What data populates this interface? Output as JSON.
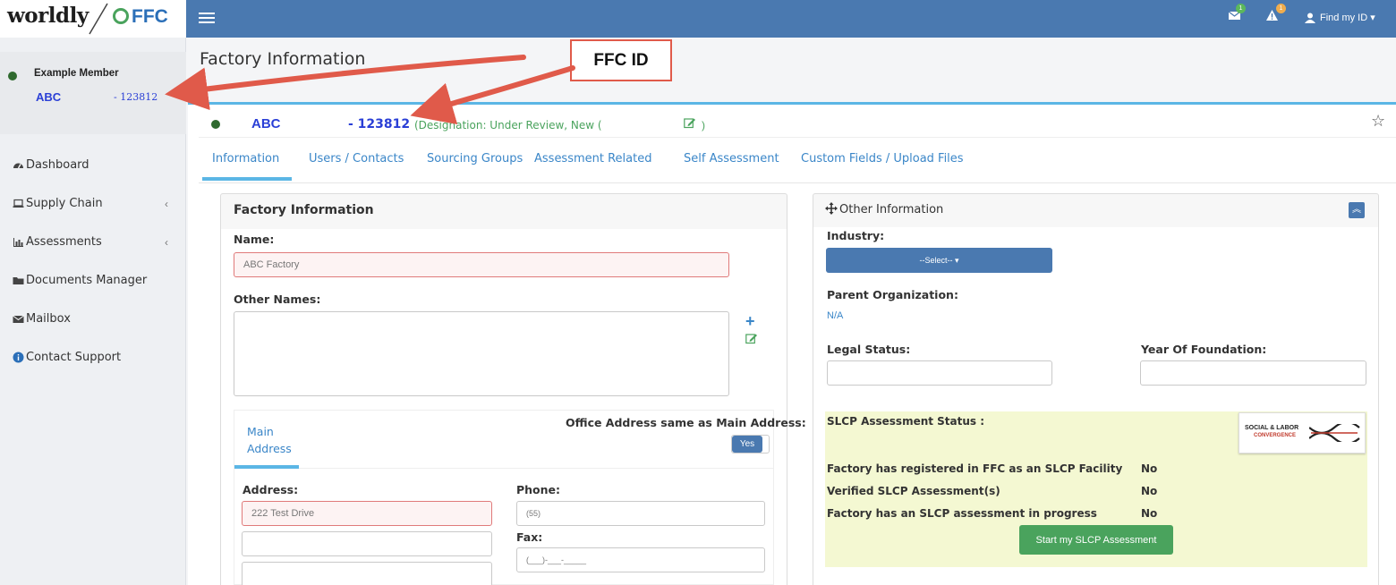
{
  "brand": {
    "worldly": "worldly",
    "ffc": "FFC"
  },
  "topbar": {
    "msg_badge": "1",
    "alert_badge": "1",
    "user_label": "Find my ID ▾"
  },
  "sidebar": {
    "member_name": "Example Member",
    "member_code": "ABC",
    "member_id": "- 123812",
    "items": [
      {
        "label": "Dashboard",
        "icon": "dashboard-icon"
      },
      {
        "label": "Supply Chain",
        "icon": "laptop-icon"
      },
      {
        "label": "Assessments",
        "icon": "bar-chart-icon"
      },
      {
        "label": "Documents Manager",
        "icon": "folder-icon"
      },
      {
        "label": "Mailbox",
        "icon": "envelope-icon"
      },
      {
        "label": "Contact Support",
        "icon": "info-icon"
      }
    ]
  },
  "page": {
    "title": "Factory Information",
    "facility_code": "ABC",
    "facility_id": "- 123812",
    "designation_open": "(Designation: Under Review, New (",
    "designation_close": ")"
  },
  "annotation": {
    "label": "FFC ID",
    "color": "#e05a4a"
  },
  "tabs": [
    "Information",
    "Users / Contacts",
    "Sourcing Groups",
    "Assessment Related",
    "Self Assessment",
    "Custom Fields / Upload Files"
  ],
  "factory_panel": {
    "title": "Factory Information",
    "name_label": "Name:",
    "name_value": "ABC Factory",
    "other_names_label": "Other Names:",
    "address_tab": "Main",
    "address_tab2": "Address",
    "office_same_label": "Office Address same as Main Address:",
    "office_same_value": "Yes",
    "address_label": "Address:",
    "address_value": "222 Test Drive",
    "phone_label": "Phone:",
    "phone_value": "(55)",
    "fax_label": "Fax:",
    "fax_value": "(___)-___-_____"
  },
  "other_panel": {
    "title": "Other Information",
    "industry_label": "Industry:",
    "industry_select": "--Select-- ▾",
    "parent_label": "Parent Organization:",
    "parent_value": "N/A",
    "legal_label": "Legal Status:",
    "year_label": "Year Of Foundation:",
    "slcp_status_label": "SLCP Assessment Status :",
    "slcp_logo_top": "SOCIAL & LABOR",
    "slcp_logo_bottom": "CONVERGENCE",
    "slcp_rows": [
      {
        "label": "Factory has registered in FFC as an SLCP Facility",
        "value": "No"
      },
      {
        "label": "Verified SLCP Assessment(s)",
        "value": "No"
      },
      {
        "label": "Factory has an SLCP assessment in progress",
        "value": "No"
      }
    ],
    "start_button": "Start my SLCP Assessment"
  },
  "colors": {
    "accent": "#4a79b0",
    "tab_blue": "#3a86c8",
    "green": "#4aa35d",
    "error": "#e07a7a"
  }
}
